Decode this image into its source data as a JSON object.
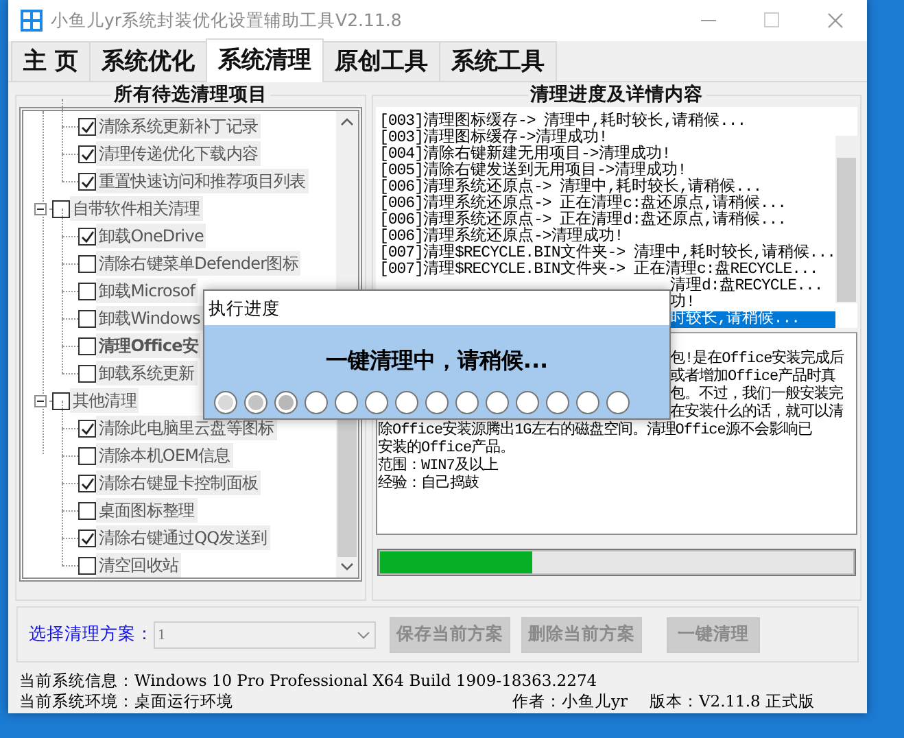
{
  "window": {
    "title": "小鱼儿yr系统封装优化设置辅助工具V2.11.8"
  },
  "tabs": [
    {
      "label": "主 页",
      "selected": false
    },
    {
      "label": "系统优化",
      "selected": false
    },
    {
      "label": "系统清理",
      "selected": true
    },
    {
      "label": "原创工具",
      "selected": false
    },
    {
      "label": "系统工具",
      "selected": false
    }
  ],
  "tree_panel": {
    "title": "所有待选清理项目",
    "items": [
      {
        "children": [
          {
            "label": "清除系统更新补丁记录",
            "checked": true
          },
          {
            "label": "清理传递优化下载内容",
            "checked": true
          },
          {
            "label": "重置快速访问和推荐项目列表",
            "checked": true
          }
        ]
      },
      {
        "label": "自带软件相关清理",
        "checked": false,
        "expanded": true,
        "children": [
          {
            "label": "卸载OneDrive",
            "checked": true
          },
          {
            "label": "清除右键菜单Defender图标",
            "checked": false
          },
          {
            "label": "卸载Microsof",
            "checked": false
          },
          {
            "label": "卸载Windows",
            "checked": false
          },
          {
            "label": "清理Office安",
            "checked": false,
            "bold": true
          },
          {
            "label": "卸载系统更新",
            "checked": false
          }
        ]
      },
      {
        "label": "其他清理",
        "checked": false,
        "expanded": true,
        "children": [
          {
            "label": "清除此电脑里云盘等图标",
            "checked": true
          },
          {
            "label": "清除本机OEM信息",
            "checked": false
          },
          {
            "label": "清除右键显卡控制面板",
            "checked": true
          },
          {
            "label": "桌面图标整理",
            "checked": false
          },
          {
            "label": "清除右键通过QQ发送到",
            "checked": true
          },
          {
            "label": "清空回收站",
            "checked": false
          }
        ]
      }
    ]
  },
  "log_panel": {
    "title": "清理进度及详情内容",
    "lines": [
      {
        "text": "[003]清理图标缓存-> 清理中,耗时较长,请稍候...",
        "kind": "full",
        "selected": false
      },
      {
        "text": "[003]清理图标缓存->清理成功!",
        "kind": "full",
        "selected": false
      },
      {
        "text": "[004]清除右键新建无用项目->清理成功!",
        "kind": "full",
        "selected": false
      },
      {
        "text": "[005]清除右键发送到无用项目->清理成功!",
        "kind": "full",
        "selected": false
      },
      {
        "text": "[006]清理系统还原点-> 清理中,耗时较长,请稍候...",
        "kind": "full",
        "selected": false
      },
      {
        "text": "[006]清理系统还原点-> 正在清理c:盘还原点,请稍候...",
        "kind": "full",
        "selected": false
      },
      {
        "text": "[006]清理系统还原点-> 正在清理d:盘还原点,请稍候...",
        "kind": "full",
        "selected": false
      },
      {
        "text": "[006]清理系统还原点->清理成功!",
        "kind": "full",
        "selected": false
      },
      {
        "text": "[007]清理$RECYCLE.BIN文件夹-> 清理中,耗时较长,请稍候...",
        "kind": "full",
        "selected": false
      },
      {
        "text": "[007]清理$RECYCLE.BIN文件夹-> 正在清理c:盘RECYCLE...",
        "kind": "full",
        "selected": false
      },
      {
        "text": "清理d:盘RECYCLE...",
        "kind": "partial",
        "selected": false
      },
      {
        "text": "功!",
        "kind": "partial",
        "selected": false
      },
      {
        "text": "时较长,请稍候...",
        "kind": "partial",
        "selected": true
      }
    ]
  },
  "details": {
    "lines": [
      {
        "text": "包!是在Office安装完成后",
        "kind": "partial"
      },
      {
        "text": "或者增加Office产品时真",
        "kind": "partial"
      },
      {
        "text": "包。不过，我们一般安装完",
        "kind": "partial"
      },
      {
        "text": "在安装什么的话，就可以清",
        "kind": "partial"
      },
      {
        "text": "除Office安装源腾出1G左右的磁盘空间。清理Office源不会影响已",
        "kind": "full"
      },
      {
        "text": "安装的Office产品。",
        "kind": "full"
      },
      {
        "text": "范围：WIN7及以上",
        "kind": "full"
      },
      {
        "text": "经验：自己捣鼓",
        "kind": "full"
      }
    ]
  },
  "progress": {
    "level": 0.32
  },
  "scheme": {
    "label": "选择清理方案：",
    "value": "1",
    "disabled": true
  },
  "buttons": [
    {
      "label": "保存当前方案",
      "disabled": true
    },
    {
      "label": "删除当前方案",
      "disabled": true
    },
    {
      "label": "一键清理",
      "disabled": true
    }
  ],
  "status": {
    "system_info": "当前系统信息：Windows 10 Pro Professional X64 Build 1909-18363.2274",
    "environment": "当前系统环境：桌面运行环境",
    "author": "作者：小鱼儿yr",
    "version": "版本：V2.11.8 正式版"
  },
  "dialog": {
    "title": "执行进度",
    "message": "一键清理中，请稍候...",
    "dots": [
      {
        "color": "#d9d9d9"
      },
      {
        "color": "#c4c4c4"
      },
      {
        "color": "#b8b8b8"
      },
      {
        "color": "#ffffff"
      },
      {
        "color": "#ffffff"
      },
      {
        "color": "#ffffff"
      },
      {
        "color": "#ffffff"
      },
      {
        "color": "#ffffff"
      },
      {
        "color": "#ffffff"
      },
      {
        "color": "#ffffff"
      },
      {
        "color": "#ffffff"
      },
      {
        "color": "#ffffff"
      },
      {
        "color": "#ffffff"
      },
      {
        "color": "#ffffff"
      }
    ]
  }
}
